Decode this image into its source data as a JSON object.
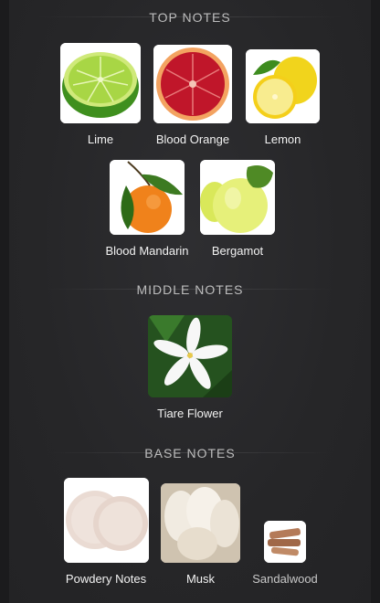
{
  "sections": {
    "top": {
      "title": "TOP NOTES",
      "notes": [
        {
          "label": "Lime",
          "icon": "lime-image"
        },
        {
          "label": "Blood Orange",
          "icon": "blood-orange-image"
        },
        {
          "label": "Lemon",
          "icon": "lemon-image"
        },
        {
          "label": "Blood Mandarin",
          "icon": "mandarin-image"
        },
        {
          "label": "Bergamot",
          "icon": "bergamot-image"
        }
      ]
    },
    "middle": {
      "title": "MIDDLE NOTES",
      "notes": [
        {
          "label": "Tiare Flower",
          "icon": "tiare-flower-image"
        }
      ]
    },
    "base": {
      "title": "BASE NOTES",
      "notes": [
        {
          "label": "Powdery Notes",
          "icon": "powder-image"
        },
        {
          "label": "Musk",
          "icon": "musk-image"
        },
        {
          "label": "Sandalwood",
          "icon": "sandalwood-image"
        }
      ]
    }
  },
  "colors": {
    "background": "#252527",
    "title": "#bdbdbd",
    "label": "#f2f2f2"
  }
}
